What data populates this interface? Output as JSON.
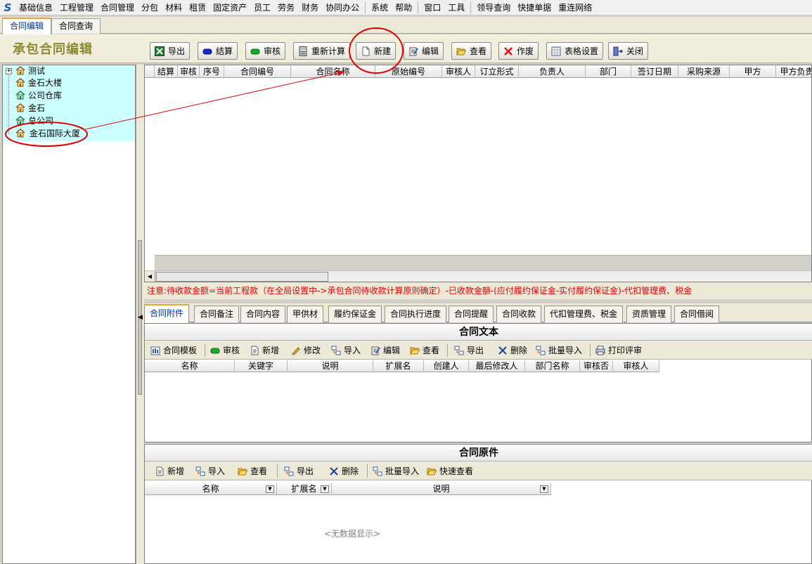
{
  "menubar": {
    "logo": "S",
    "items": [
      "基础信息",
      "工程管理",
      "合同管理",
      "分包",
      "材料",
      "租赁",
      "固定资产",
      "员工",
      "劳务",
      "财务",
      "协同办公",
      "系统",
      "帮助",
      "窗口",
      "工具",
      "领导查询",
      "快捷单据",
      "重连网络"
    ]
  },
  "doc_tabs": [
    "合同编辑",
    "合同查询"
  ],
  "page_title": "承包合同编辑",
  "toolbar": {
    "export": "导出",
    "settle": "结算",
    "audit": "审核",
    "recalc": "重新计算",
    "new": "新建",
    "edit": "编辑",
    "view": "查看",
    "void": "作废",
    "table_settings": "表格设置",
    "close": "关闭"
  },
  "tree": {
    "root": "测试",
    "children": [
      "金石大楼",
      "公司仓库",
      "金石",
      "总公司",
      "金石国际大厦"
    ]
  },
  "grid": {
    "columns": [
      "结算",
      "审核",
      "序号",
      "合同编号",
      "合同名称",
      "原始编号",
      "审核人",
      "订立形式",
      "负责人",
      "部门",
      "签订日期",
      "采购来源",
      "甲方",
      "甲方负责"
    ]
  },
  "notice": "注意:待收款金额=当前工程款（在全局设置中->承包合同待收款计算原则确定）-已收款金额-(应付履约保证金-实付履约保证金)-代扣管理费、税金",
  "sub_tabs": [
    "合同附件",
    "合同备注",
    "合同内容",
    "甲供材",
    "履约保证金",
    "合同执行进度",
    "合同提醒",
    "合同收款",
    "代扣管理费、税金",
    "资质管理",
    "合同借阅"
  ],
  "text_panel": {
    "title": "合同文本",
    "buttons": [
      "合同模板",
      "审核",
      "新增",
      "修改",
      "导入",
      "编辑",
      "查看",
      "导出",
      "删除",
      "批量导入",
      "打印评审"
    ],
    "columns": [
      "名称",
      "关键字",
      "说明",
      "扩展名",
      "创建人",
      "最后修改人",
      "部门名称",
      "审核否",
      "审核人"
    ]
  },
  "orig_panel": {
    "title": "合同原件",
    "buttons": [
      "新增",
      "导入",
      "查看",
      "导出",
      "删除",
      "批量导入",
      "快速查看"
    ],
    "columns": [
      "名称",
      "扩展名",
      "说明"
    ],
    "empty": "<无数据显示>"
  },
  "colors": {
    "annotation": "#e00000",
    "title": "#8c8b32",
    "selection": "#0a246a",
    "tree_bg": "#ccffff"
  }
}
